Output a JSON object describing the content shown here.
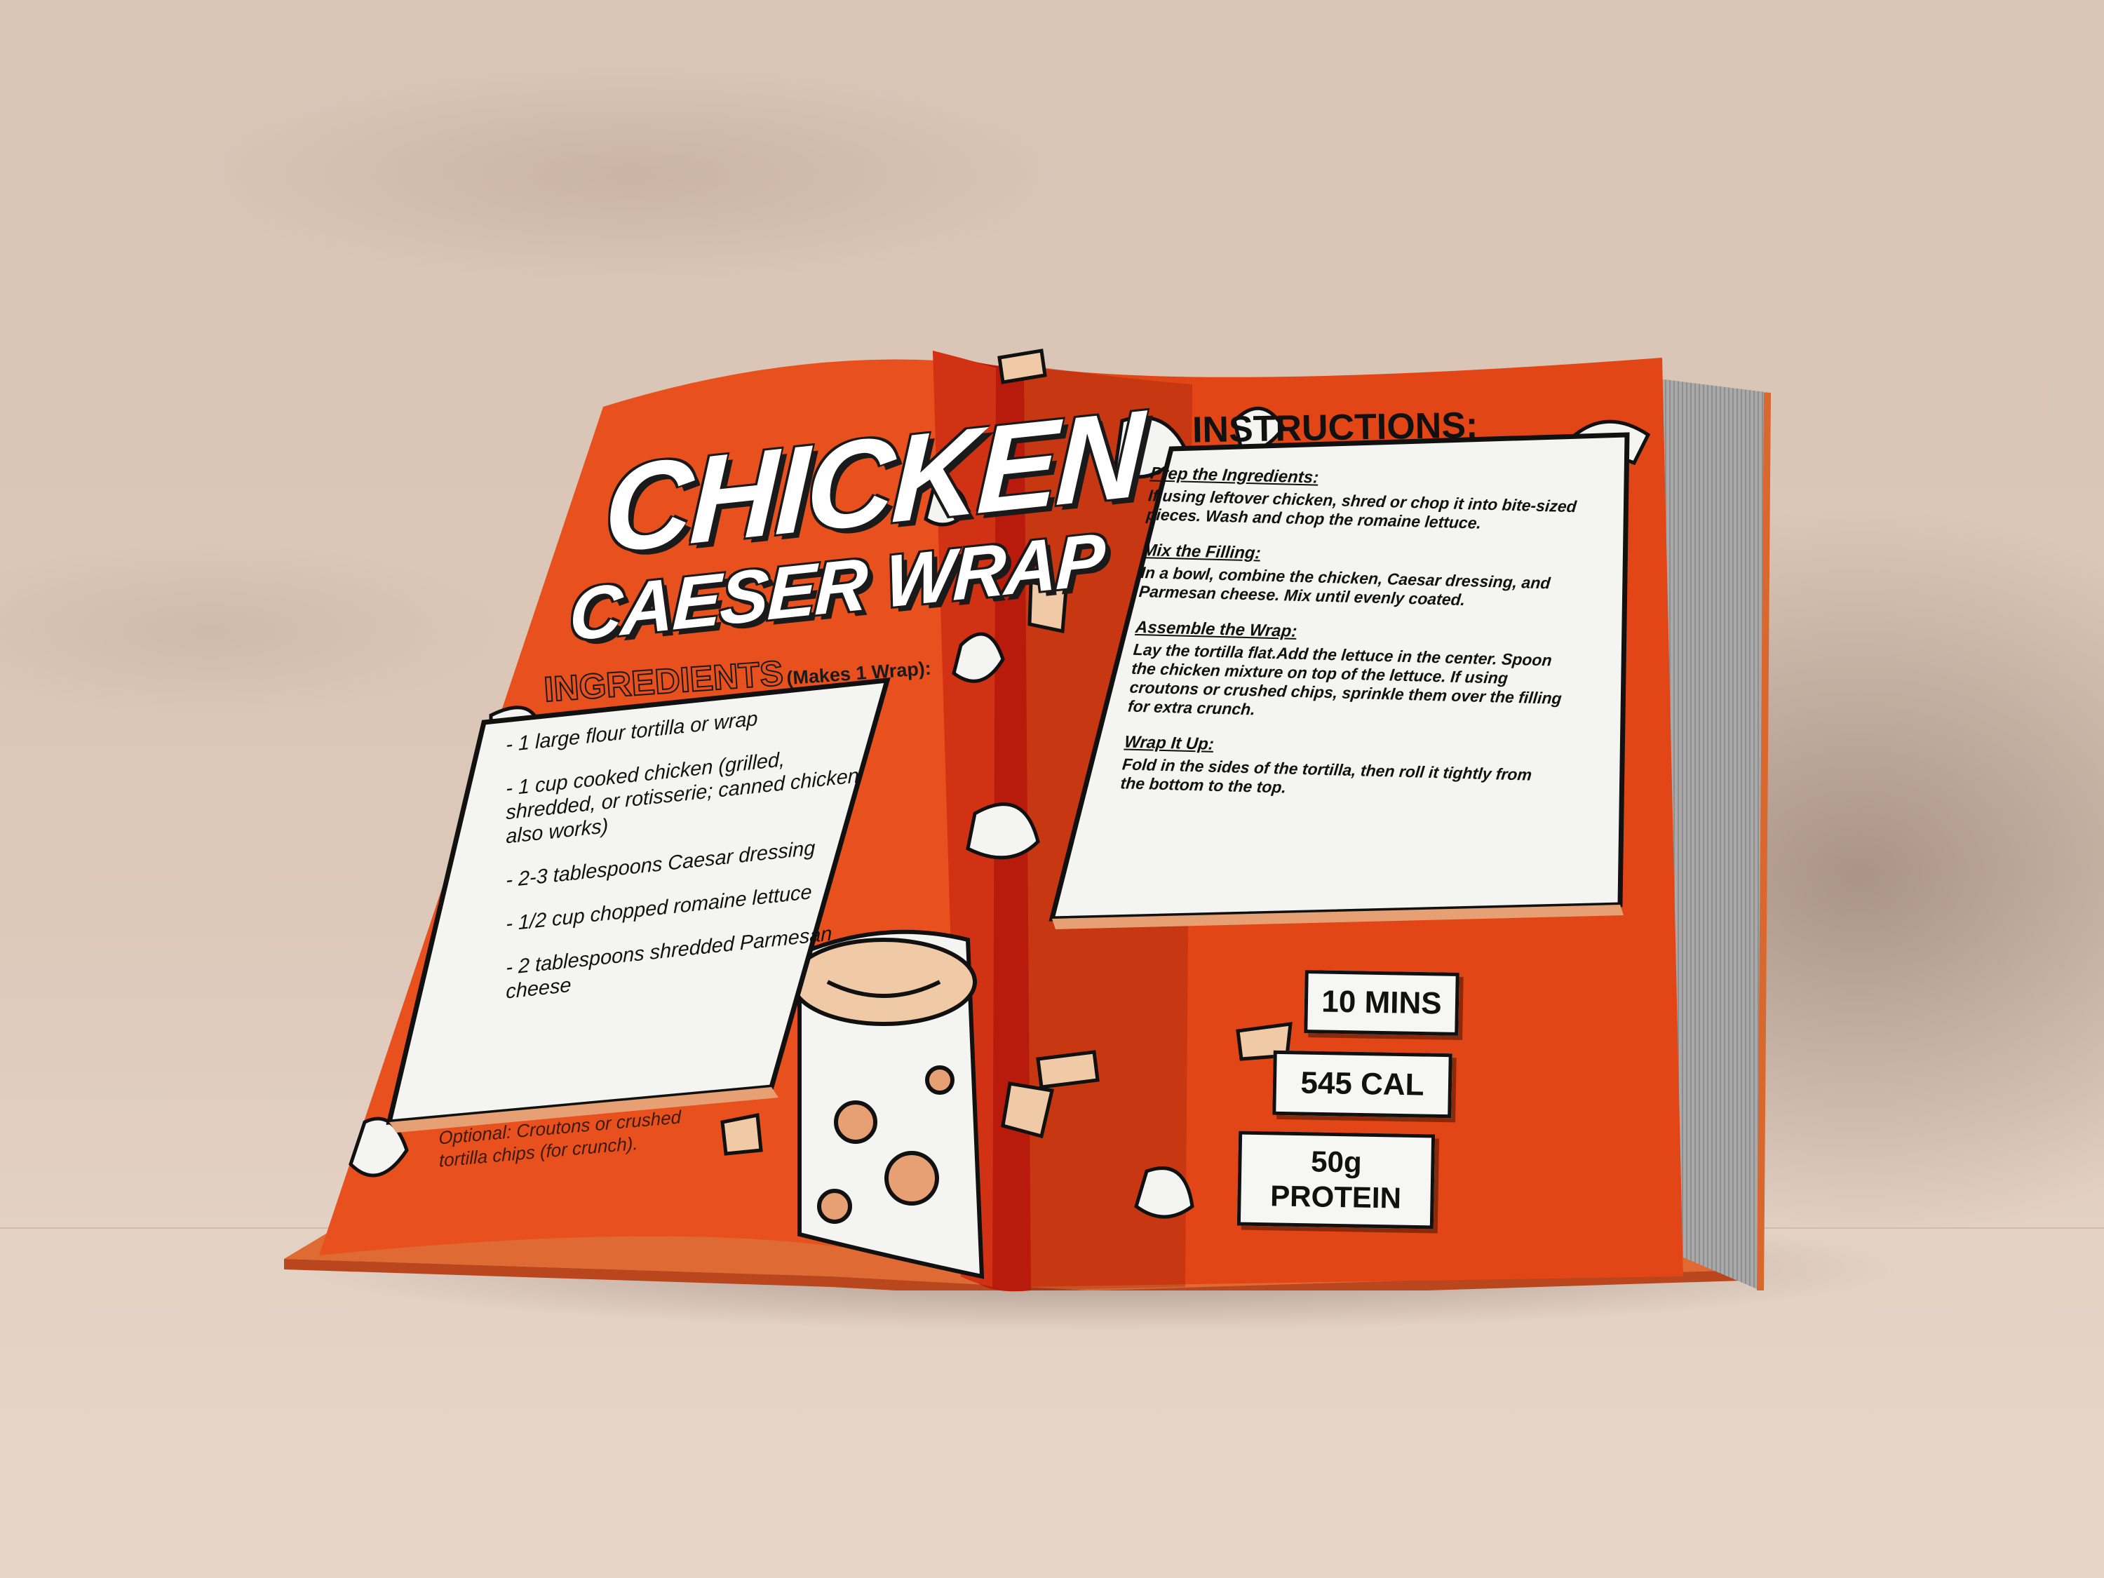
{
  "recipe": {
    "title_line1": "CHICKEN",
    "title_line2": "CAESER WRAP",
    "ingredients_heading": "INGREDIENTS",
    "ingredients_yield": "(Makes 1 Wrap):",
    "ingredients": [
      "- 1 large flour tortilla or wrap",
      "- 1 cup cooked chicken (grilled, shredded, or rotisserie; canned chicken also works)",
      "- 2-3 tablespoons Caesar dressing",
      "- 1/2 cup chopped romaine lettuce",
      "- 2 tablespoons shredded Parmesan cheese"
    ],
    "optional_note": "Optional: Croutons or crushed tortilla chips (for crunch).",
    "instructions_heading": "INSTRUCTIONS:",
    "steps": [
      {
        "heading": "Prep the Ingredients:",
        "body": "If using leftover chicken, shred or chop it into bite-sized pieces. Wash and chop the romaine lettuce."
      },
      {
        "heading": "Mix the Filling:",
        "body": "In a bowl, combine the chicken, Caesar dressing, and Parmesan cheese. Mix until evenly coated."
      },
      {
        "heading": "Assemble the Wrap:",
        "body": "Lay the tortilla flat.Add the lettuce in the center. Spoon the chicken mixture on top of the lettuce. If using croutons or crushed chips, sprinkle them over the filling for extra crunch."
      },
      {
        "heading": "Wrap It Up:",
        "body": "Fold in the sides of the tortilla, then roll it tightly from the bottom to the top."
      }
    ],
    "stats": {
      "time": "10 MINS",
      "calories": "545 CAL",
      "protein_line1": "50g",
      "protein_line2": "PROTEIN"
    }
  },
  "colors": {
    "page_orange": "#e8511d",
    "spine_red": "#c91c0c",
    "accent_peach": "#e6a074",
    "background": "#dcc7b8"
  }
}
